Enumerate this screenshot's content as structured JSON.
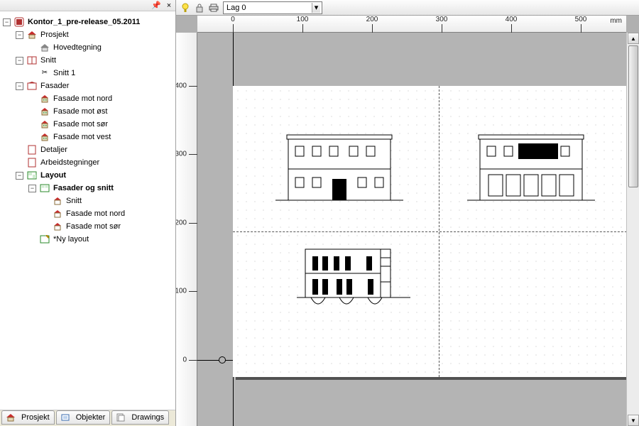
{
  "panel_header": {
    "pushpin": "📌",
    "close": "×"
  },
  "tree": {
    "project_name": "Kontor_1_pre-release_05.2011",
    "prosjekt": {
      "label": "Prosjekt",
      "hovedtegning": "Hovedtegning"
    },
    "snitt": {
      "label": "Snitt",
      "items": [
        "Snitt 1"
      ]
    },
    "fasader": {
      "label": "Fasader",
      "items": [
        "Fasade mot nord",
        "Fasade mot øst",
        "Fasade mot sør",
        "Fasade mot vest"
      ]
    },
    "detaljer": "Detaljer",
    "arbeidstegninger": "Arbeidstegninger",
    "layout": {
      "label": "Layout",
      "group_label": "Fasader og snitt",
      "items": [
        "Snitt",
        "Fasade mot nord",
        "Fasade mot sør"
      ],
      "new_layout": "*Ny layout"
    }
  },
  "tabs": {
    "prosjekt": "Prosjekt",
    "objekter": "Objekter",
    "drawings": "Drawings"
  },
  "layer_bar": {
    "current_layer": "Lag 0"
  },
  "ruler": {
    "unit_label": "mm",
    "h_ticks": [
      0,
      100,
      200,
      300,
      400,
      500
    ],
    "v_ticks": [
      0,
      100,
      200,
      300,
      400
    ]
  }
}
